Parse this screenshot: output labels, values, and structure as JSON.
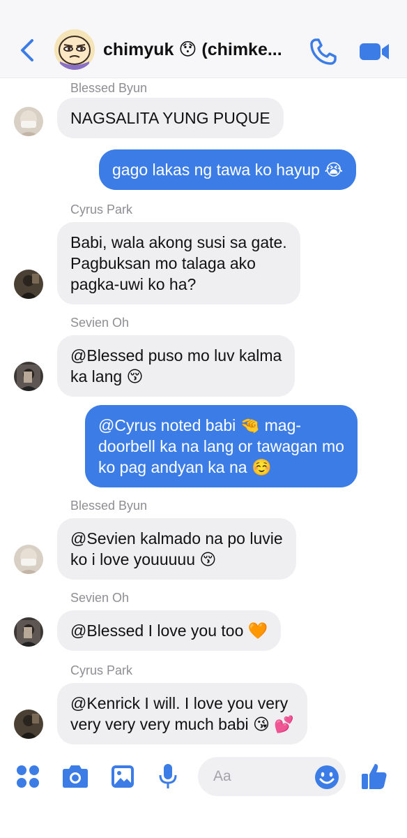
{
  "header": {
    "title": "chimyuk 😯 (chimke..."
  },
  "messages": [
    {
      "sender": "Blessed Byun",
      "text": "NAGSALITA YUNG PUQUE",
      "direction": "incoming"
    },
    {
      "sender": "",
      "text": "gago lakas ng tawa ko hayup 😭",
      "direction": "outgoing"
    },
    {
      "sender": "Cyrus Park",
      "lines": [
        "Babi, wala akong susi sa gate.",
        "Pagbuksan mo talaga ako",
        "pagka-uwi ko ha?"
      ],
      "direction": "incoming"
    },
    {
      "sender": "Sevien Oh",
      "lines": [
        "@Blessed puso mo luv kalma",
        "ka lang 😚"
      ],
      "direction": "incoming"
    },
    {
      "sender": "",
      "lines": [
        "@Cyrus noted babi 🤏 mag-",
        "doorbell ka na lang or tawagan mo",
        "ko pag andyan ka na ☺️"
      ],
      "direction": "outgoing"
    },
    {
      "sender": "Blessed Byun",
      "lines": [
        "@Sevien kalmado na po luvie",
        "ko i love youuuuu 😚"
      ],
      "direction": "incoming"
    },
    {
      "sender": "Sevien Oh",
      "text": "@Blessed I love you too 🧡",
      "direction": "incoming"
    },
    {
      "sender": "Cyrus Park",
      "lines": [
        "@Kenrick I will. I love you very",
        "very very very much babi 😘 💕"
      ],
      "direction": "incoming"
    }
  ],
  "composer": {
    "placeholder": "Aa"
  },
  "colors": {
    "accent": "#3b7ce7",
    "incoming_bubble": "#efeff2",
    "header_bg": "#f7f7f9"
  },
  "icons": {
    "back": "chevron-left-icon",
    "call": "phone-icon",
    "video": "video-camera-icon",
    "apps": "four-dots-icon",
    "camera": "camera-icon",
    "gallery": "image-icon",
    "mic": "microphone-icon",
    "emoji": "smiley-icon",
    "like": "thumbs-up-icon"
  }
}
